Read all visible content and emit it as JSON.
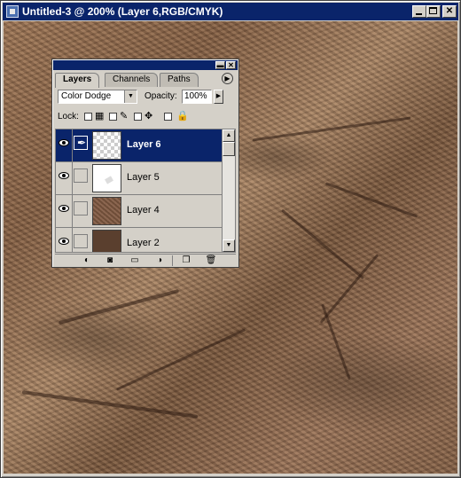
{
  "window": {
    "title": "Untitled-3 @ 200% (Layer 6,RGB/CMYK)"
  },
  "layers_palette": {
    "tabs": [
      {
        "label": "Layers",
        "active": true
      },
      {
        "label": "Channels",
        "active": false
      },
      {
        "label": "Paths",
        "active": false
      }
    ],
    "blend_mode": "Color Dodge",
    "opacity_label": "Opacity:",
    "opacity_value": "100%",
    "lock_label": "Lock:",
    "layers": [
      {
        "name": "Layer 6",
        "selected": true,
        "visible": true,
        "thumbnail": "transparent-checker"
      },
      {
        "name": "Layer 5",
        "selected": false,
        "visible": true,
        "thumbnail": "white"
      },
      {
        "name": "Layer 4",
        "selected": false,
        "visible": true,
        "thumbnail": "brown-texture"
      },
      {
        "name": "Layer 2",
        "selected": false,
        "visible": true,
        "thumbnail": "dark-brown"
      }
    ],
    "bottom_icons": [
      "layer-style-icon",
      "mask-icon",
      "new-set-icon",
      "adjustment-layer-icon",
      "new-layer-icon",
      "trash-icon"
    ]
  },
  "colors": {
    "titlebar": "#0a246a",
    "selection": "#0a246a",
    "chrome": "#d4d0c8"
  }
}
